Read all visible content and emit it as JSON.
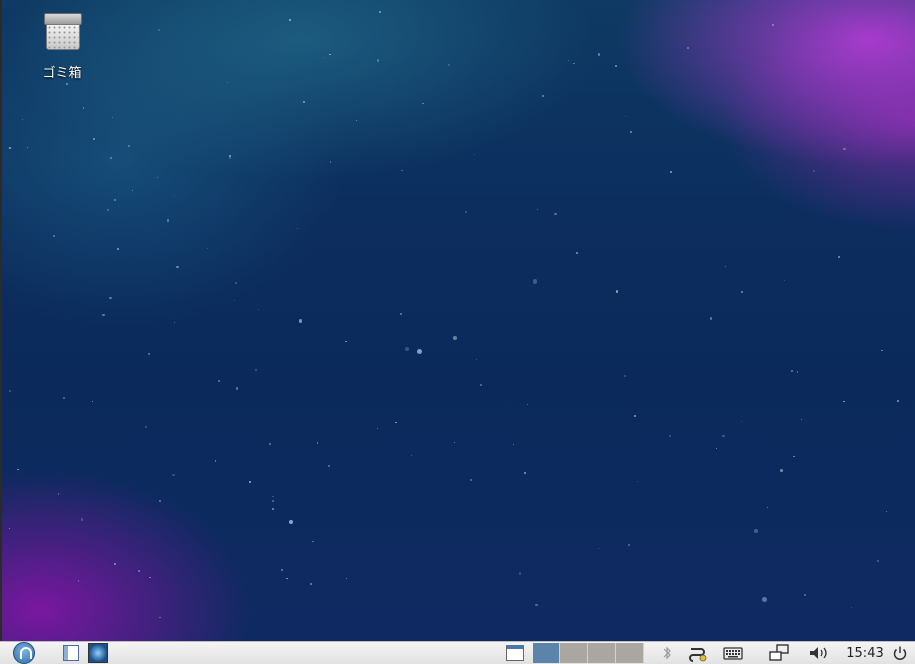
{
  "desktop": {
    "icons": [
      {
        "label": "ゴミ箱",
        "icon": "trash-icon"
      }
    ]
  },
  "taskbar": {
    "menu_icon": "start-menu-icon",
    "launchers": [
      {
        "icon": "file-manager-icon"
      },
      {
        "icon": "web-browser-icon"
      }
    ],
    "show_desktop_icon": "show-desktop-icon",
    "workspaces": [
      {
        "active": true
      },
      {
        "active": false
      },
      {
        "active": false
      },
      {
        "active": false
      }
    ],
    "tray": {
      "bluetooth_icon": "bluetooth-icon",
      "network_icon": "network-icon",
      "keyboard_icon": "keyboard-icon",
      "display_icon": "display-icon",
      "volume_icon": "volume-icon",
      "power_icon": "power-icon"
    },
    "clock": "15:43"
  },
  "colors": {
    "active_workspace": "#5c83aa",
    "inactive_workspace": "#aaa6a0",
    "taskbar_bg": "#e9e9e9"
  }
}
